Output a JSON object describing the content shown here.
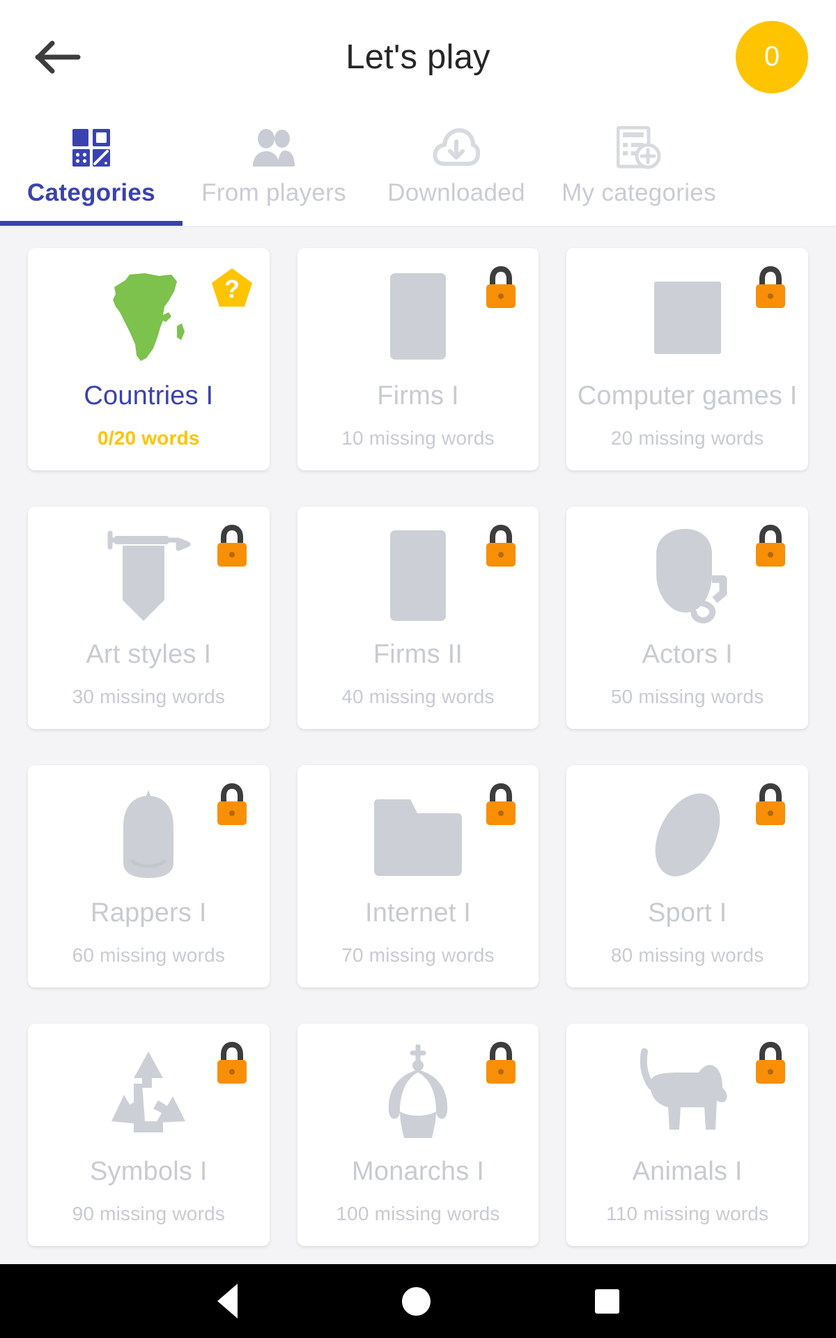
{
  "header": {
    "back_icon": "arrow-left-icon",
    "title": "Let's play",
    "score": "0"
  },
  "tabs": [
    {
      "label": "Categories",
      "icon": "grid-categories-icon",
      "active": true
    },
    {
      "label": "From players",
      "icon": "people-icon",
      "active": false
    },
    {
      "label": "Downloaded",
      "icon": "cloud-download-icon",
      "active": false
    },
    {
      "label": "My categories",
      "icon": "add-list-icon",
      "active": false
    }
  ],
  "colors": {
    "accent_blue": "#3a42b0",
    "accent_yellow": "#ffc400",
    "lock_orange": "#f88f07",
    "muted_gray": "#c8cbd2",
    "africa_green": "#7cc24c",
    "page_bg": "#f4f4f6"
  },
  "categories": [
    {
      "title": "Countries I",
      "subtitle": "0/20 words",
      "icon": "africa-map-icon",
      "badge": "question-pentagon-icon",
      "locked": false
    },
    {
      "title": "Firms I",
      "subtitle": "10 missing words",
      "icon": "rectangle-icon",
      "badge": "lock-icon",
      "locked": true
    },
    {
      "title": "Computer games I",
      "subtitle": "20 missing words",
      "icon": "square-icon",
      "badge": "lock-icon",
      "locked": true
    },
    {
      "title": "Art styles I",
      "subtitle": "30 missing words",
      "icon": "banner-icon",
      "badge": "lock-icon",
      "locked": true
    },
    {
      "title": "Firms II",
      "subtitle": "40 missing words",
      "icon": "rectangle-icon",
      "badge": "lock-icon",
      "locked": true
    },
    {
      "title": "Actors I",
      "subtitle": "50 missing words",
      "icon": "theatre-mask-icon",
      "badge": "lock-icon",
      "locked": true
    },
    {
      "title": "Rappers I",
      "subtitle": "60 missing words",
      "icon": "cap-icon",
      "badge": "lock-icon",
      "locked": true
    },
    {
      "title": "Internet I",
      "subtitle": "70 missing words",
      "icon": "folder-icon",
      "badge": "lock-icon",
      "locked": true
    },
    {
      "title": "Sport I",
      "subtitle": "80 missing words",
      "icon": "football-icon",
      "badge": "lock-icon",
      "locked": true
    },
    {
      "title": "Symbols I",
      "subtitle": "90 missing words",
      "icon": "recycle-icon",
      "badge": "lock-icon",
      "locked": true
    },
    {
      "title": "Monarchs I",
      "subtitle": "100 missing words",
      "icon": "crown-icon",
      "badge": "lock-icon",
      "locked": true
    },
    {
      "title": "Animals I",
      "subtitle": "110 missing words",
      "icon": "dog-icon",
      "badge": "lock-icon",
      "locked": true
    }
  ],
  "system_nav": {
    "back": "nav-back-icon",
    "home": "nav-home-icon",
    "recents": "nav-recents-icon"
  }
}
